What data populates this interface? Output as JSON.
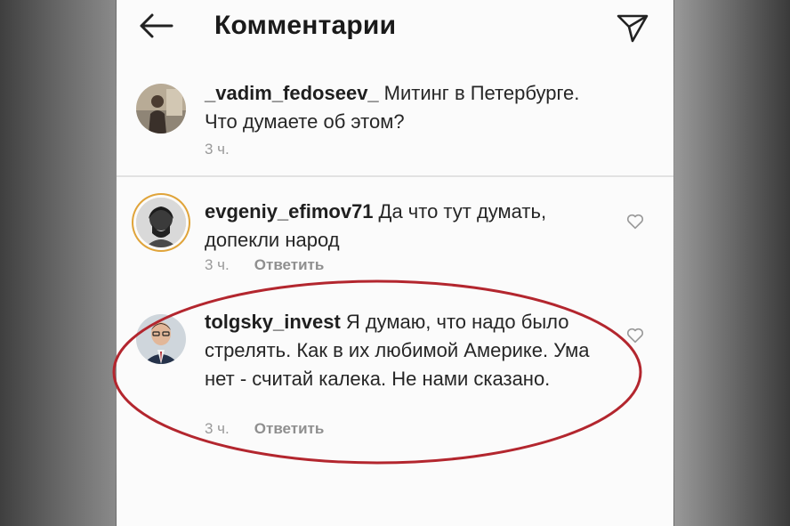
{
  "header": {
    "title": "Комментарии"
  },
  "post": {
    "username": "_vadim_fedoseev_",
    "text": "Митинг в Петербурге. Что думаете об этом?",
    "time": "3 ч."
  },
  "comments": [
    {
      "username": "evgeniy_efimov71",
      "text": "Да что тут думать, допекли народ",
      "time": "3 ч.",
      "reply_label": "Ответить"
    },
    {
      "username": "tolgsky_invest",
      "text": "Я думаю, что надо было стрелять. Как в их любимой Америке. Ума нет - считай калека. Не нами сказано.",
      "time": "3 ч.",
      "reply_label": "Ответить"
    }
  ],
  "colors": {
    "annotation": "#b3262e",
    "story_ring": "#e0a43a"
  }
}
